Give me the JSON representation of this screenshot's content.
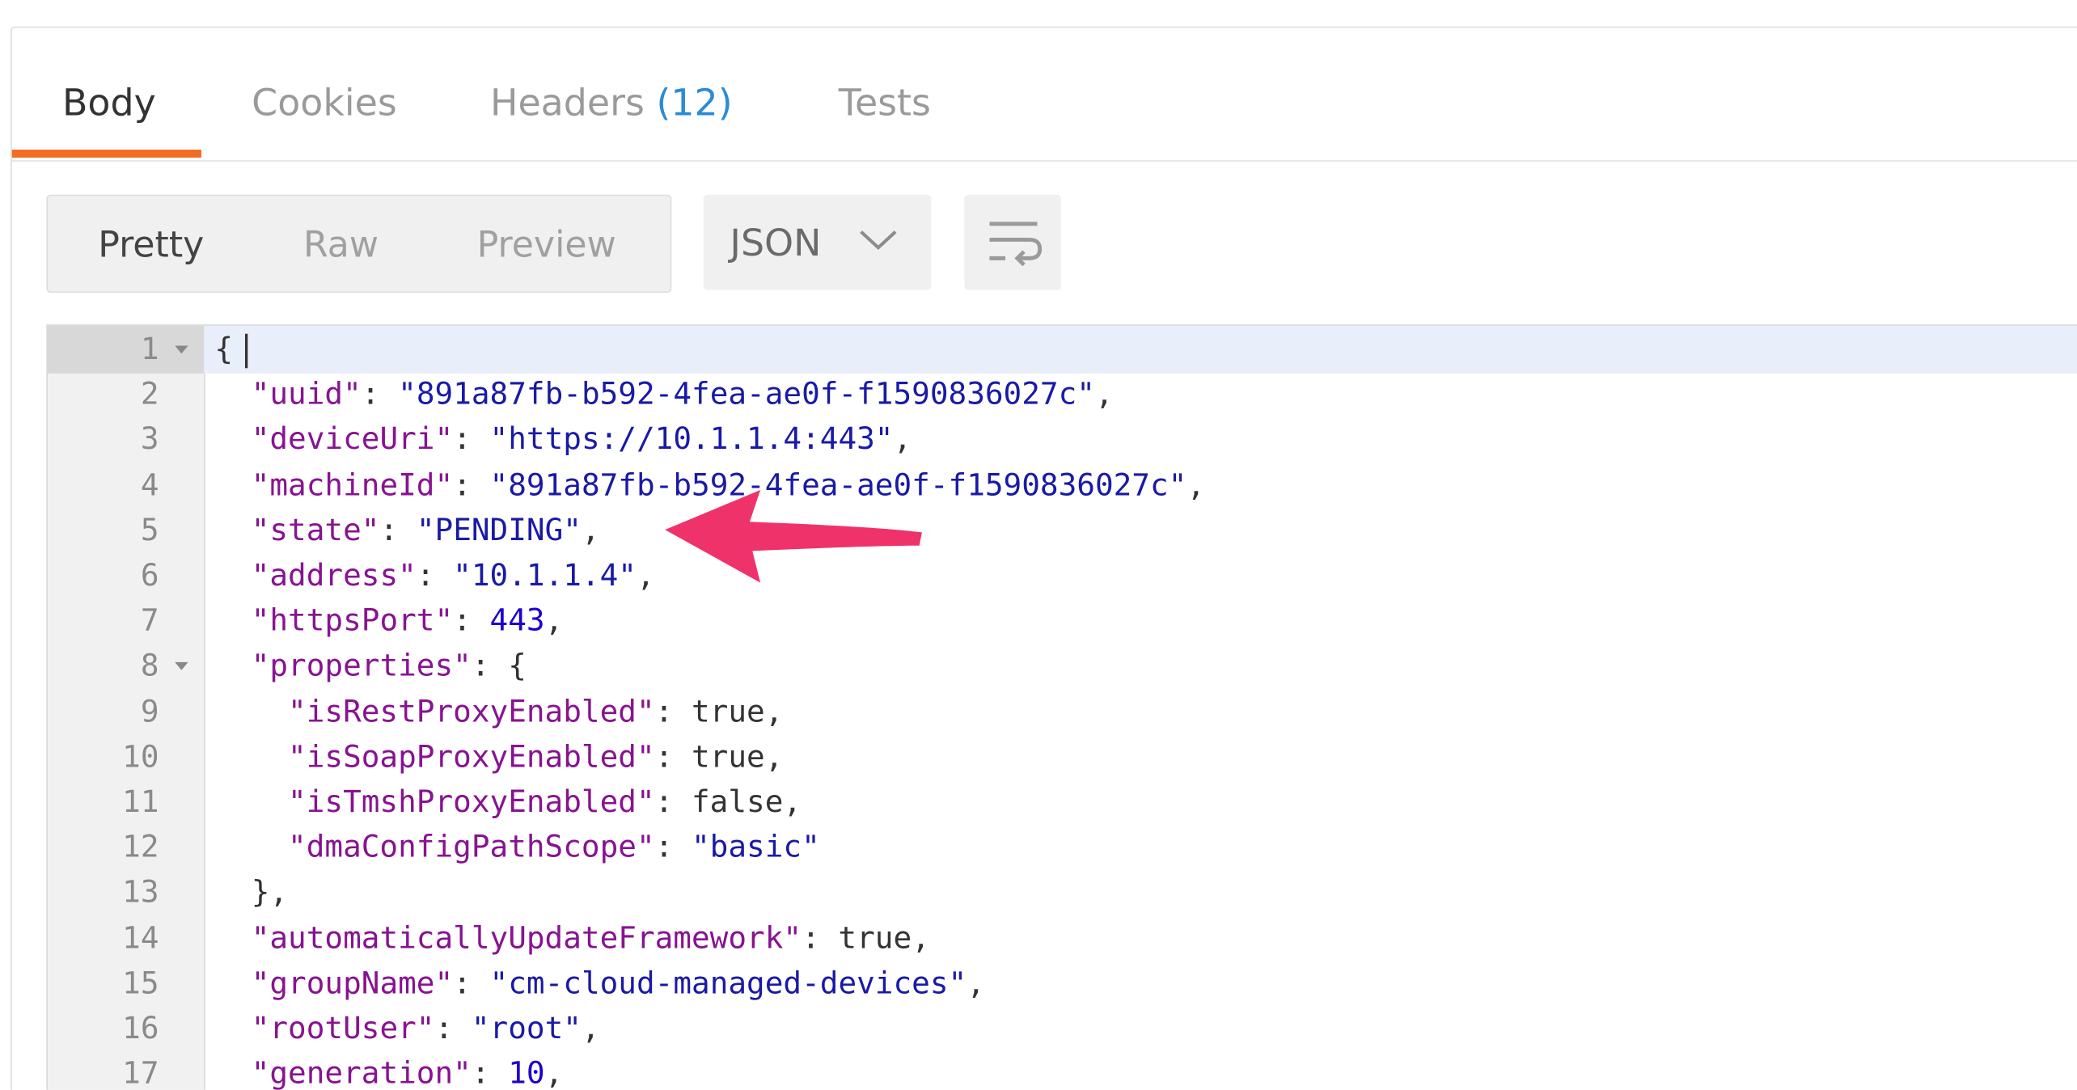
{
  "tabs": [
    {
      "label": "Body",
      "active": true
    },
    {
      "label": "Cookies",
      "active": false
    },
    {
      "label": "Headers",
      "count": "(12)",
      "active": false
    },
    {
      "label": "Tests",
      "active": false
    }
  ],
  "view_modes": [
    "Pretty",
    "Raw",
    "Preview"
  ],
  "active_view_mode": "Pretty",
  "format": {
    "label": "JSON",
    "icon": "chevron-down-icon"
  },
  "wrap_button": {
    "icon": "wrap-lines-icon"
  },
  "annotation": {
    "icon": "arrow-left-icon",
    "color": "#f0326b"
  },
  "colors": {
    "accent": "#f36c24",
    "key": "#881391",
    "string": "#1a1aa6",
    "number": "#1c00cf",
    "header_count": "#2b8bd6"
  },
  "code_lines": [
    {
      "num": "1",
      "fold": true,
      "indent": "",
      "tokens": [
        {
          "t": "p",
          "v": "{"
        }
      ]
    },
    {
      "num": "2",
      "fold": false,
      "indent": "  ",
      "tokens": [
        {
          "t": "k",
          "v": "\"uuid\""
        },
        {
          "t": "p",
          "v": ": "
        },
        {
          "t": "s",
          "v": "\"891a87fb-b592-4fea-ae0f-f1590836027c\""
        },
        {
          "t": "p",
          "v": ","
        }
      ]
    },
    {
      "num": "3",
      "fold": false,
      "indent": "  ",
      "tokens": [
        {
          "t": "k",
          "v": "\"deviceUri\""
        },
        {
          "t": "p",
          "v": ": "
        },
        {
          "t": "s",
          "v": "\"https://10.1.1.4:443\""
        },
        {
          "t": "p",
          "v": ","
        }
      ]
    },
    {
      "num": "4",
      "fold": false,
      "indent": "  ",
      "tokens": [
        {
          "t": "k",
          "v": "\"machineId\""
        },
        {
          "t": "p",
          "v": ": "
        },
        {
          "t": "s",
          "v": "\"891a87fb-b592-4fea-ae0f-f1590836027c\""
        },
        {
          "t": "p",
          "v": ","
        }
      ]
    },
    {
      "num": "5",
      "fold": false,
      "indent": "  ",
      "tokens": [
        {
          "t": "k",
          "v": "\"state\""
        },
        {
          "t": "p",
          "v": ": "
        },
        {
          "t": "s",
          "v": "\"PENDING\""
        },
        {
          "t": "p",
          "v": ","
        }
      ]
    },
    {
      "num": "6",
      "fold": false,
      "indent": "  ",
      "tokens": [
        {
          "t": "k",
          "v": "\"address\""
        },
        {
          "t": "p",
          "v": ": "
        },
        {
          "t": "s",
          "v": "\"10.1.1.4\""
        },
        {
          "t": "p",
          "v": ","
        }
      ]
    },
    {
      "num": "7",
      "fold": false,
      "indent": "  ",
      "tokens": [
        {
          "t": "k",
          "v": "\"httpsPort\""
        },
        {
          "t": "p",
          "v": ": "
        },
        {
          "t": "n",
          "v": "443"
        },
        {
          "t": "p",
          "v": ","
        }
      ]
    },
    {
      "num": "8",
      "fold": true,
      "indent": "  ",
      "tokens": [
        {
          "t": "k",
          "v": "\"properties\""
        },
        {
          "t": "p",
          "v": ": {"
        }
      ]
    },
    {
      "num": "9",
      "fold": false,
      "indent": "    ",
      "tokens": [
        {
          "t": "k",
          "v": "\"isRestProxyEnabled\""
        },
        {
          "t": "p",
          "v": ": true,"
        }
      ]
    },
    {
      "num": "10",
      "fold": false,
      "indent": "    ",
      "tokens": [
        {
          "t": "k",
          "v": "\"isSoapProxyEnabled\""
        },
        {
          "t": "p",
          "v": ": true,"
        }
      ]
    },
    {
      "num": "11",
      "fold": false,
      "indent": "    ",
      "tokens": [
        {
          "t": "k",
          "v": "\"isTmshProxyEnabled\""
        },
        {
          "t": "p",
          "v": ": false,"
        }
      ]
    },
    {
      "num": "12",
      "fold": false,
      "indent": "    ",
      "tokens": [
        {
          "t": "k",
          "v": "\"dmaConfigPathScope\""
        },
        {
          "t": "p",
          "v": ": "
        },
        {
          "t": "s",
          "v": "\"basic\""
        }
      ]
    },
    {
      "num": "13",
      "fold": false,
      "indent": "  ",
      "tokens": [
        {
          "t": "p",
          "v": "},"
        }
      ]
    },
    {
      "num": "14",
      "fold": false,
      "indent": "  ",
      "tokens": [
        {
          "t": "k",
          "v": "\"automaticallyUpdateFramework\""
        },
        {
          "t": "p",
          "v": ": true,"
        }
      ]
    },
    {
      "num": "15",
      "fold": false,
      "indent": "  ",
      "tokens": [
        {
          "t": "k",
          "v": "\"groupName\""
        },
        {
          "t": "p",
          "v": ": "
        },
        {
          "t": "s",
          "v": "\"cm-cloud-managed-devices\""
        },
        {
          "t": "p",
          "v": ","
        }
      ]
    },
    {
      "num": "16",
      "fold": false,
      "indent": "  ",
      "tokens": [
        {
          "t": "k",
          "v": "\"rootUser\""
        },
        {
          "t": "p",
          "v": ": "
        },
        {
          "t": "s",
          "v": "\"root\""
        },
        {
          "t": "p",
          "v": ","
        }
      ]
    },
    {
      "num": "17",
      "fold": false,
      "indent": "  ",
      "tokens": [
        {
          "t": "k",
          "v": "\"generation\""
        },
        {
          "t": "p",
          "v": ": "
        },
        {
          "t": "n",
          "v": "10"
        },
        {
          "t": "p",
          "v": ","
        }
      ]
    }
  ]
}
